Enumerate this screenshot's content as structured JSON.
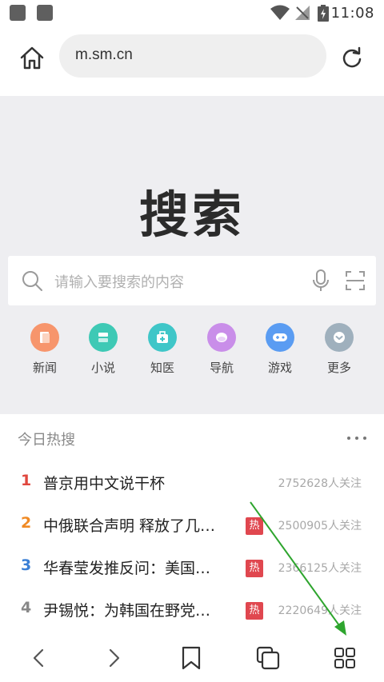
{
  "status_bar": {
    "time": "11:08"
  },
  "address_bar": {
    "url": "m.sm.cn"
  },
  "search": {
    "logo_text": "搜索",
    "placeholder": "请输入要搜索的内容"
  },
  "quick_links": [
    {
      "label": "新闻",
      "color": "#f7956c",
      "icon": "news-icon"
    },
    {
      "label": "小说",
      "color": "#3ec9b5",
      "icon": "book-icon"
    },
    {
      "label": "知医",
      "color": "#3fc6c8",
      "icon": "medical-kit-icon"
    },
    {
      "label": "导航",
      "color": "#c98ee9",
      "icon": "compass-icon"
    },
    {
      "label": "游戏",
      "color": "#5a9cf2",
      "icon": "gamepad-icon"
    },
    {
      "label": "更多",
      "color": "#9fb0bd",
      "icon": "chevron-down-icon"
    }
  ],
  "hot_search": {
    "title": "今日热搜",
    "items": [
      {
        "rank": "1",
        "text": "普京用中文说干杯",
        "badge": "",
        "count": "2752628人关注",
        "rank_color": "#e0473e"
      },
      {
        "rank": "2",
        "text": "中俄联合声明 释放了几…",
        "badge": "热",
        "count": "2500905人关注",
        "rank_color": "#f08a24"
      },
      {
        "rank": "3",
        "text": "华春莹发推反问：美国…",
        "badge": "热",
        "count": "2366125人关注",
        "rank_color": "#3a7fd5"
      },
      {
        "rank": "4",
        "text": "尹锡悦：为韩国在野党…",
        "badge": "热",
        "count": "2220649人关注",
        "rank_color": "#888888"
      }
    ]
  },
  "annotation": {
    "arrow_color": "#2ea52e"
  }
}
